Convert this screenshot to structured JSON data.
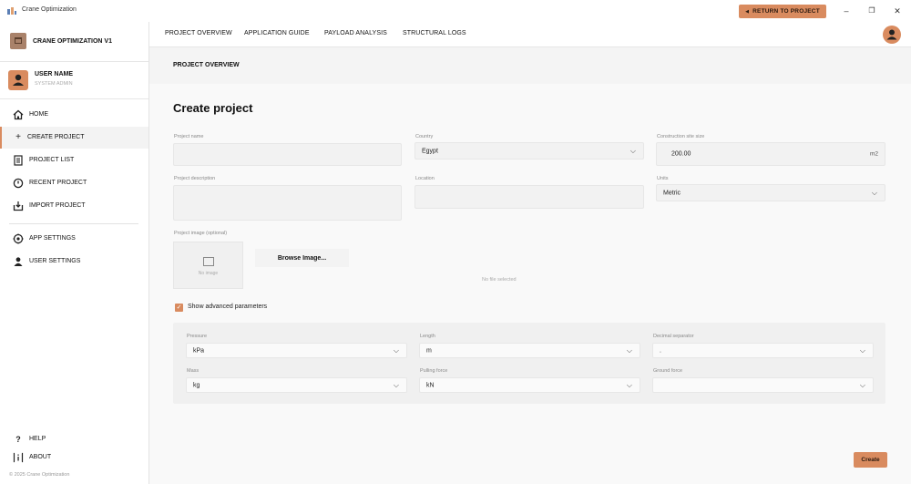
{
  "window": {
    "title": "Crane Optimization",
    "return_label": "RETURN TO PROJECT",
    "minimize": "–",
    "maximize": "❐",
    "close": "✕"
  },
  "sidebar": {
    "brand": "CRANE OPTIMIZATION V1",
    "user_name": "USER NAME",
    "user_role": "SYSTEM ADMIN",
    "items": [
      {
        "label": "HOME",
        "icon": "home-icon"
      },
      {
        "label": "CREATE PROJECT",
        "icon": "plus-icon"
      },
      {
        "label": "PROJECT LIST",
        "icon": "list-icon"
      },
      {
        "label": "RECENT PROJECT",
        "icon": "clock-icon"
      },
      {
        "label": "IMPORT PROJECT",
        "icon": "import-icon"
      },
      {
        "label": "APP SETTINGS",
        "icon": "gear-icon"
      },
      {
        "label": "USER SETTINGS",
        "icon": "user-icon"
      },
      {
        "label": "HELP",
        "icon": "help-icon"
      },
      {
        "label": "ABOUT",
        "icon": "info-icon"
      }
    ],
    "active_item": "CREATE PROJECT",
    "copyright": "© 2025 Crane Optimization"
  },
  "topnav": {
    "tabs": [
      "PROJECT OVERVIEW",
      "APPLICATION GUIDE",
      "PAYLOAD ANALYSIS",
      "STRUCTURAL LOGS"
    ]
  },
  "breadcrumb": "PROJECT OVERVIEW",
  "form": {
    "title": "Create project",
    "project_name": {
      "label": "Project name",
      "value": ""
    },
    "country": {
      "label": "Country",
      "value": "Egypt"
    },
    "site_size": {
      "label": "Construction site size",
      "value": "200.00",
      "unit": "m2"
    },
    "description": {
      "label": "Project description",
      "value": ""
    },
    "location": {
      "label": "Location",
      "value": ""
    },
    "units": {
      "label": "Units",
      "value": "Metric"
    },
    "image": {
      "label": "Project image (optional)",
      "placeholder": "No image",
      "browse": "Browse Image...",
      "no_file": "No file selected"
    },
    "advanced": {
      "label": "Show advanced parameters",
      "checked": true
    },
    "pressure": {
      "label": "Pressure",
      "value": "kPa"
    },
    "length": {
      "label": "Length",
      "value": "m"
    },
    "decimal": {
      "label": "Decimal separator",
      "value": "."
    },
    "mass": {
      "label": "Mass",
      "value": "kg"
    },
    "pulling": {
      "label": "Pulling force",
      "value": "kN"
    },
    "ground": {
      "label": "Ground force",
      "value": ""
    },
    "create": "Create"
  },
  "colors": {
    "accent": "#d98b5f",
    "background": "#f9f9f9",
    "field": "#f2f2f2"
  }
}
